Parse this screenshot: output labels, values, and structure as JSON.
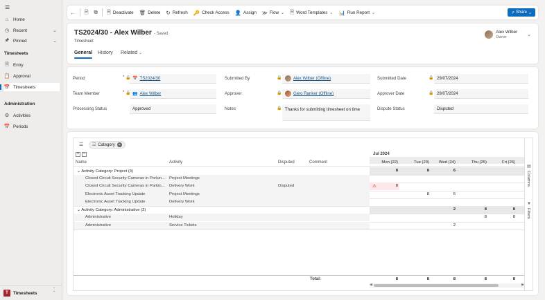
{
  "sidebar": {
    "items": [
      {
        "label": "Home",
        "icon": "home-icon"
      },
      {
        "label": "Recent",
        "icon": "clock-icon"
      },
      {
        "label": "Pinned",
        "icon": "pin-icon"
      }
    ],
    "sections": [
      {
        "title": "Timesheets",
        "items": [
          {
            "label": "Entry",
            "icon": "document-icon"
          },
          {
            "label": "Approval",
            "icon": "clipboard-icon"
          },
          {
            "label": "Timesheets",
            "icon": "calendar-icon",
            "active": true
          }
        ]
      },
      {
        "title": "Administration",
        "items": [
          {
            "label": "Activities",
            "icon": "puzzle-icon"
          },
          {
            "label": "Periods",
            "icon": "calendar-icon"
          }
        ]
      }
    ],
    "area": {
      "letter": "T",
      "label": "Timesheets",
      "color": "#a4262c"
    }
  },
  "commandbar": {
    "deactivate": "Deactivate",
    "delete": "Delete",
    "refresh": "Refresh",
    "check_access": "Check Access",
    "assign": "Assign",
    "flow": "Flow",
    "word_templates": "Word Templates",
    "run_report": "Run Report",
    "share": "Share"
  },
  "header": {
    "title": "TS2024/30 - Alex Wilber",
    "saved": "- Saved",
    "entity": "Timesheet",
    "owner_name": "Alex Wilber",
    "owner_role": "Owner",
    "tabs": [
      "General",
      "History",
      "Related"
    ]
  },
  "form": {
    "period": {
      "label": "Period",
      "value": "TS2024/30"
    },
    "team_member": {
      "label": "Team Member",
      "value": "Alex Wilber"
    },
    "processing_status": {
      "label": "Processing Status",
      "value": "Approved"
    },
    "submitted_by": {
      "label": "Submitted By",
      "value": "Alex Wilber (Offline)"
    },
    "approver": {
      "label": "Approver",
      "value": "Gero Ranker (Offline)"
    },
    "notes": {
      "label": "Notes",
      "value": "Thanks for submitting timesheet on time"
    },
    "submitted_date": {
      "label": "Submitted Date",
      "value": "29/07/2024"
    },
    "approved_date": {
      "label": "Approver Date",
      "value": "29/07/2024"
    },
    "dispute_status": {
      "label": "Dispute Status",
      "value": "Disputed"
    }
  },
  "grid": {
    "group_chip": "Category",
    "month": "Jul 2024",
    "columns": {
      "name": "Name",
      "activity": "Activity",
      "disputed": "Disputed",
      "comment": "Comment"
    },
    "days": [
      "Mon (22)",
      "Tue (23)",
      "Wed (24)",
      "Thu (25)",
      "Fri (26)"
    ],
    "groups": [
      {
        "label": "Activity Category: Project (4)",
        "totals": [
          "8",
          "8",
          "6",
          "",
          ""
        ],
        "rows": [
          {
            "name": "Closed Circuit Security Cameras in Porlun...",
            "activity": "Project Meetings",
            "disputed": "",
            "values": [
              "",
              "",
              "",
              "",
              ""
            ]
          },
          {
            "name": "Closed Circuit Security Cameras in Parkin...",
            "activity": "Delivery Work",
            "disputed": "Disputed",
            "values": [
              "8",
              "",
              "",
              "",
              ""
            ],
            "warning": true
          },
          {
            "name": "Electronic Asset Tracking Update",
            "activity": "Project Meetings",
            "disputed": "",
            "values": [
              "",
              "8",
              "6",
              "",
              ""
            ]
          },
          {
            "name": "Electronic Asset Tracking Update",
            "activity": "Delivery Work",
            "disputed": "",
            "values": [
              "",
              "",
              "",
              "",
              ""
            ]
          }
        ]
      },
      {
        "label": "Activity Category: Administrative (2)",
        "totals": [
          "",
          "",
          "2",
          "8",
          "8"
        ],
        "rows": [
          {
            "name": "Administrative",
            "activity": "Holiday",
            "disputed": "",
            "values": [
              "",
              "",
              "",
              "8",
              "8"
            ]
          },
          {
            "name": "Administrative",
            "activity": "Service Tickets",
            "disputed": "",
            "values": [
              "",
              "",
              "2",
              "",
              ""
            ]
          }
        ]
      }
    ],
    "total_label": "Total:",
    "totals": [
      "8",
      "8",
      "8",
      "8",
      "8"
    ],
    "side_tabs": [
      "Columns",
      "Filters"
    ]
  }
}
